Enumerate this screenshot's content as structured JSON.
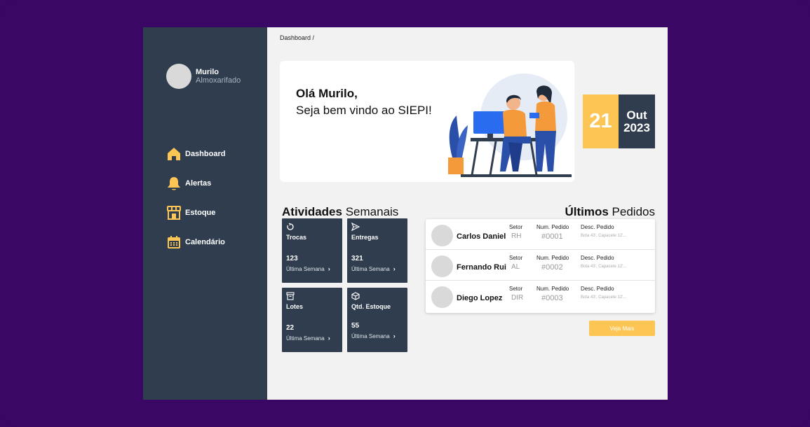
{
  "profile": {
    "name": "Murilo",
    "role": "Almoxarifado"
  },
  "nav": [
    {
      "label": "Dashboard",
      "icon": "home-icon"
    },
    {
      "label": "Alertas",
      "icon": "bell-icon"
    },
    {
      "label": "Estoque",
      "icon": "store-icon"
    },
    {
      "label": "Calendário",
      "icon": "calendar-icon"
    }
  ],
  "breadcrumb": "Dashboard /",
  "hero": {
    "title": "Olá Murilo,",
    "subtitle": "Seja bem vindo ao SIEPI!"
  },
  "date": {
    "day": "21",
    "month": "Out",
    "year": "2023"
  },
  "activities": {
    "title_bold": "Atividades",
    "title_rest": " Semanais",
    "cards": [
      {
        "label": "Trocas",
        "value": "123",
        "footer": "Última Semana",
        "icon": "refresh-icon"
      },
      {
        "label": "Entregas",
        "value": "321",
        "footer": "Última Semana",
        "icon": "send-icon"
      },
      {
        "label": "Lotes",
        "value": "22",
        "footer": "Última Semana",
        "icon": "archive-icon"
      },
      {
        "label": "Qtd. Estoque",
        "value": "55",
        "footer": "Última Semana",
        "icon": "box-icon"
      }
    ]
  },
  "orders": {
    "title_bold": "Últimos",
    "title_rest": " Pedidos",
    "headers": {
      "setor": "Setor",
      "num": "Num. Pedido",
      "desc": "Desc. Pedido"
    },
    "rows": [
      {
        "name": "Carlos Daniel",
        "setor": "RH",
        "num": "#0001",
        "desc": "Bota 43', Capacete 12'..."
      },
      {
        "name": "Fernando Rui",
        "setor": "AL",
        "num": "#0002",
        "desc": "Bota 43', Capacete 12'..."
      },
      {
        "name": "Diego Lopez",
        "setor": "DIR",
        "num": "#0003",
        "desc": "Bota 43', Capacete 12'..."
      }
    ],
    "more_label": "Veja Mais"
  },
  "colors": {
    "accent": "#fdc654",
    "dark": "#2f3d4e",
    "background": "#3a0764"
  }
}
